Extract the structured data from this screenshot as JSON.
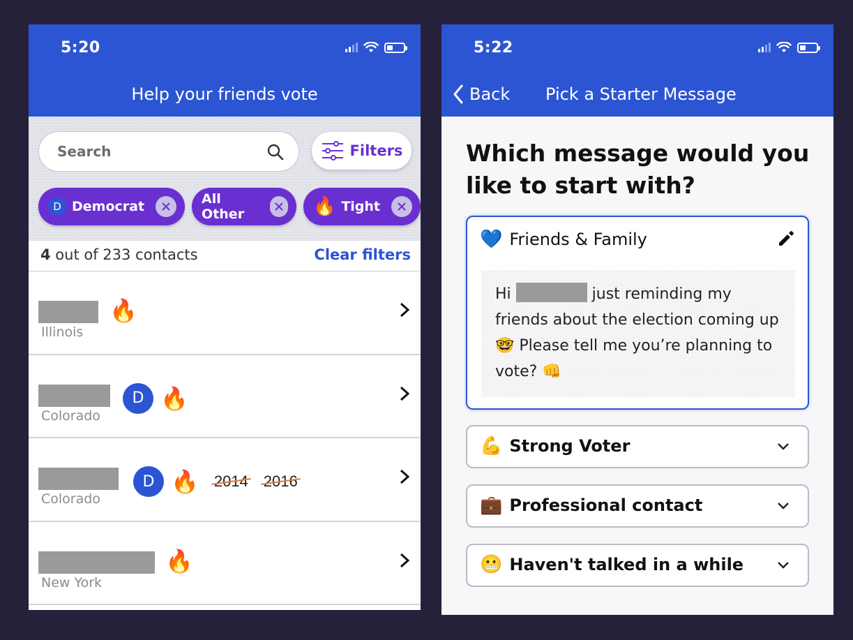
{
  "left": {
    "status": {
      "time": "5:20"
    },
    "nav": {
      "title": "Help your friends vote"
    },
    "search": {
      "placeholder": "Search"
    },
    "filters_label": "Filters",
    "chips": [
      {
        "prefix": "D",
        "label": "Democrat"
      },
      {
        "label": "All Other"
      },
      {
        "prefix_icon": "fire-icon",
        "label": "Tight"
      }
    ],
    "count": {
      "number": "4",
      "rest": " out of 233 contacts"
    },
    "clear_label": "Clear filters",
    "contacts": [
      {
        "state": "Illinois",
        "badges": [
          "fire"
        ]
      },
      {
        "state": "Colorado",
        "badges": [
          "D",
          "fire"
        ]
      },
      {
        "state": "Colorado",
        "badges": [
          "D",
          "fire"
        ],
        "years": [
          "2014",
          "2016"
        ]
      },
      {
        "state": "New York",
        "badges": [
          "fire"
        ]
      }
    ]
  },
  "right": {
    "status": {
      "time": "5:22"
    },
    "nav": {
      "back": "Back",
      "title": "Pick a Starter Message"
    },
    "question": "Which message would you like to start with?",
    "open_card": {
      "emoji": "💙",
      "title": "Friends & Family",
      "message_start": "Hi ",
      "message_rest": " just reminding my friends about the election coming up ",
      "emoji_nerd": "🤓",
      "message_end": " Please tell me you’re planning to vote? ",
      "emoji_fist": "👊"
    },
    "cards": [
      {
        "emoji": "💪",
        "title": "Strong Voter"
      },
      {
        "emoji": "💼",
        "title": "Professional contact"
      },
      {
        "emoji": "😬",
        "title": "Haven't talked in a while"
      }
    ]
  },
  "colors": {
    "brand_blue": "#2c55d3",
    "purple": "#6a2fd1",
    "fire": "#f28b2c"
  }
}
